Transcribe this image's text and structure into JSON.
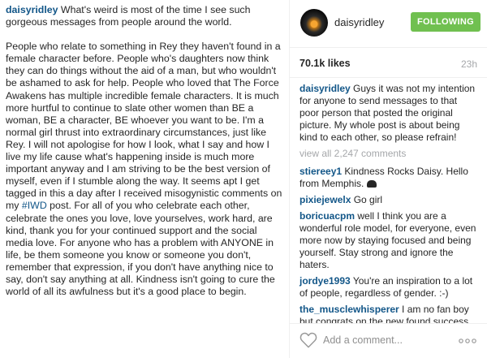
{
  "caption": {
    "username": "daisyridley",
    "intro": " What's weird is most of the time I see such gorgeous messages from people around the world.",
    "para2_before_tag": "People who relate to something in Rey they haven't found in a female character before. People who's daughters now think they can do things without the aid of a man, but who wouldn't be ashamed to ask for help. People who loved that The Force Awakens has multiple incredible female characters. It is much more hurtful to continue to slate other women than BE a woman, BE a character, BE whoever you want to be. I'm a normal girl thrust into extraordinary circumstances, just like Rey. I will not apologise for how I look, what I say and how I live my life cause what's happening inside is much more important anyway and I am striving to be the best version of myself, even if I stumble along the way. It seems apt I get tagged in this a day after I received misogynistic comments on my ",
    "hashtag": "#IWD",
    "para2_after_tag": " post. For all of you who celebrate each other, celebrate the ones you love, love yourselves, work hard, are kind, thank you for your continued support and the social media love. For anyone who has a problem with ANYONE in life, be them someone you know or someone you don't, remember that expression, if you don't have anything nice to say, don't say anything at all. Kindness isn't going to cure the world of all its awfulness but it's a good place to begin."
  },
  "header": {
    "username": "daisyridley",
    "follow_label": "FOLLOWING",
    "avatar_icon": "profile-avatar"
  },
  "meta": {
    "likes": "70.1k likes",
    "time": "23h"
  },
  "comments": {
    "first": {
      "user": "daisyridley",
      "text": " Guys it was not my intention for anyone to send messages to that poor person that posted the original picture. My whole post is about being kind to each other, so please refrain!"
    },
    "view_all": "view all 2,247 comments",
    "list": [
      {
        "user": "stiereey1",
        "text": " Kindness Rocks Daisy. Hello from Memphis. "
      },
      {
        "user": "pixiejewelx",
        "text": " Go girl"
      },
      {
        "user": "boricuacpm",
        "text": " well I think you are a wonderful role model, for everyone, even more now by staying focused and being yourself. Stay strong and ignore the haters."
      },
      {
        "user": "jordye1993",
        "text": " You're an inspiration to a lot of people, regardless of gender. :-)"
      },
      {
        "user": "the_musclewhisperer",
        "text": " I am no fan boy but congrats on the new found success and all the hard work you put into it and for backing what you believe in. You"
      }
    ]
  },
  "footer": {
    "placeholder": "Add a comment...",
    "like_icon": "heart-outline",
    "more_icon": "ellipsis"
  },
  "colors": {
    "link": "#125688",
    "follow_bg": "#70c050",
    "muted": "#a5a7aa"
  }
}
